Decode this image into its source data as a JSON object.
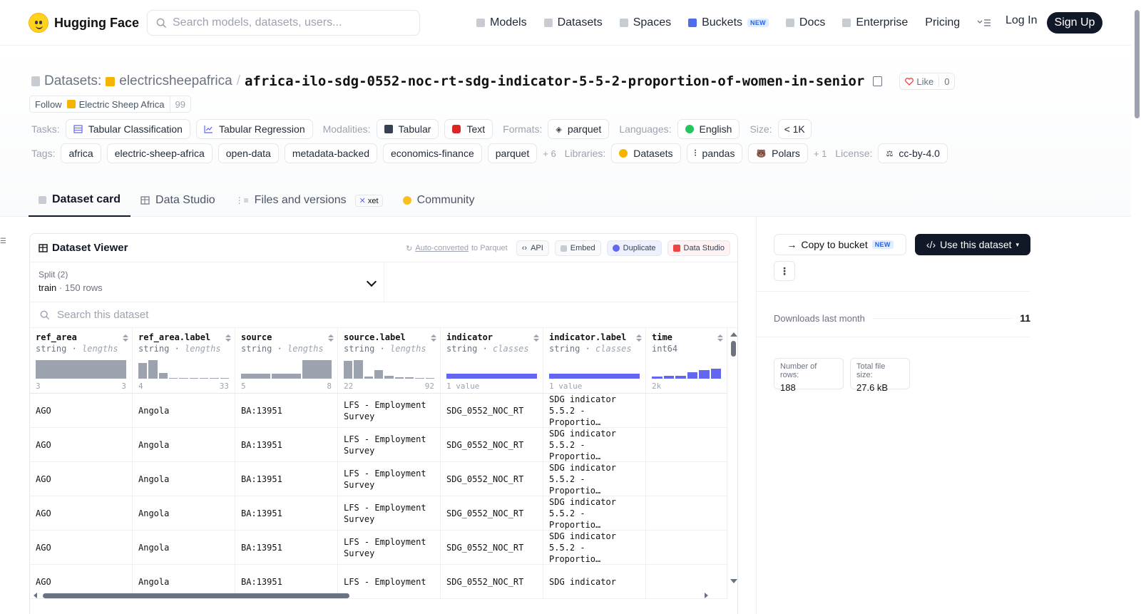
{
  "header": {
    "brand": "Hugging Face",
    "search_placeholder": "Search models, datasets, users...",
    "nav": [
      {
        "label": "Models",
        "icon": "cube-icon"
      },
      {
        "label": "Datasets",
        "icon": "database-icon"
      },
      {
        "label": "Spaces",
        "icon": "grid-icon"
      },
      {
        "label": "Buckets",
        "icon": "bucket-icon",
        "badge": "NEW"
      },
      {
        "label": "Docs",
        "icon": "book-icon"
      },
      {
        "label": "Enterprise",
        "icon": "enterprise-icon"
      },
      {
        "label": "Pricing"
      }
    ],
    "login": "Log In",
    "signup": "Sign Up"
  },
  "repo": {
    "type_label": "Datasets:",
    "owner": "electricsheepafrica",
    "separator": "/",
    "name": "africa-ilo-sdg-0552-noc-rt-sdg-indicator-5-5-2-proportion-of-women-in-senior",
    "like_label": "Like",
    "like_count": "0",
    "follow_label": "Follow",
    "org_name": "Electric Sheep Africa",
    "followers": "99"
  },
  "meta": {
    "tasks_label": "Tasks:",
    "tasks": [
      "Tabular Classification",
      "Tabular Regression"
    ],
    "modalities_label": "Modalities:",
    "modalities": [
      "Tabular",
      "Text"
    ],
    "formats_label": "Formats:",
    "formats": [
      "parquet"
    ],
    "languages_label": "Languages:",
    "languages": [
      "English"
    ],
    "size_label": "Size:",
    "size": "< 1K",
    "tags_label": "Tags:",
    "tags": [
      "africa",
      "electric-sheep-africa",
      "open-data",
      "metadata-backed",
      "economics-finance",
      "parquet"
    ],
    "tags_more": "+ 6",
    "libraries_label": "Libraries:",
    "libraries": [
      "Datasets",
      "pandas",
      "Polars"
    ],
    "libraries_more": "+ 1",
    "license_label": "License:",
    "license": "cc-by-4.0"
  },
  "tabs": [
    {
      "label": "Dataset card",
      "active": true
    },
    {
      "label": "Data Studio",
      "active": false
    },
    {
      "label": "Files and versions",
      "active": false,
      "badge": "xet"
    },
    {
      "label": "Community",
      "active": false
    }
  ],
  "viewer": {
    "title": "Dataset Viewer",
    "auto_link": "Auto-converted",
    "auto_rest": "to Parquet",
    "api": "API",
    "embed": "Embed",
    "duplicate": "Duplicate",
    "studio": "Data Studio",
    "split_label": "Split (2)",
    "split_value": "train",
    "split_sep": "·",
    "split_rows": "150 rows",
    "search_placeholder": "Search this dataset",
    "columns": [
      {
        "name": "ref_area",
        "type": "string",
        "stat": "lengths",
        "min": "3",
        "max": "3",
        "hist": [
          1
        ]
      },
      {
        "name": "ref_area.label",
        "type": "string",
        "stat": "lengths",
        "min": "4",
        "max": "33",
        "hist": [
          0.85,
          1,
          0.3,
          0.05,
          0,
          0.05,
          0,
          0.05,
          0.05
        ]
      },
      {
        "name": "source",
        "type": "string",
        "stat": "lengths",
        "min": "5",
        "max": "8",
        "hist": [
          0.25,
          0.28,
          1
        ]
      },
      {
        "name": "source.label",
        "type": "string",
        "stat": "lengths",
        "min": "22",
        "max": "92",
        "hist": [
          0.95,
          1,
          0.1,
          0.45,
          0.15,
          0.08,
          0.08,
          0.05,
          0.05
        ]
      },
      {
        "name": "indicator",
        "type": "string",
        "stat": "classes",
        "min": "1 value",
        "max": "",
        "hist": [
          0.25
        ],
        "accent": true
      },
      {
        "name": "indicator.label",
        "type": "string",
        "stat": "classes",
        "min": "1 value",
        "max": "",
        "hist": [
          0.25
        ],
        "accent": true
      },
      {
        "name": "time",
        "type": "int64",
        "stat": "",
        "min": "2k",
        "max": "",
        "hist": [
          0.1,
          0.15,
          0.15,
          0.35,
          0.45,
          0.55
        ],
        "accent": true
      }
    ],
    "rows": [
      [
        "AGO",
        "Angola",
        "BA:13951",
        "LFS - Employment\nSurvey",
        "SDG_0552_NOC_RT",
        "SDG indicator\n5.5.2 - Proportio…",
        ""
      ],
      [
        "AGO",
        "Angola",
        "BA:13951",
        "LFS - Employment\nSurvey",
        "SDG_0552_NOC_RT",
        "SDG indicator\n5.5.2 - Proportio…",
        ""
      ],
      [
        "AGO",
        "Angola",
        "BA:13951",
        "LFS - Employment\nSurvey",
        "SDG_0552_NOC_RT",
        "SDG indicator\n5.5.2 - Proportio…",
        ""
      ],
      [
        "AGO",
        "Angola",
        "BA:13951",
        "LFS - Employment\nSurvey",
        "SDG_0552_NOC_RT",
        "SDG indicator\n5.5.2 - Proportio…",
        ""
      ],
      [
        "AGO",
        "Angola",
        "BA:13951",
        "LFS - Employment\nSurvey",
        "SDG_0552_NOC_RT",
        "SDG indicator\n5.5.2 - Proportio…",
        ""
      ],
      [
        "AGO",
        "Angola",
        "BA:13951",
        "LFS - Employment",
        "SDG_0552_NOC_RT",
        "SDG indicator",
        ""
      ]
    ]
  },
  "sidebar": {
    "copy_bucket": "Copy to bucket",
    "copy_badge": "NEW",
    "use_dataset": "Use this dataset",
    "downloads_label": "Downloads last month",
    "downloads": "11",
    "rows_label": "Number of rows:",
    "rows_value": "188",
    "size_label": "Total file size:",
    "size_value": "27.6 kB"
  }
}
